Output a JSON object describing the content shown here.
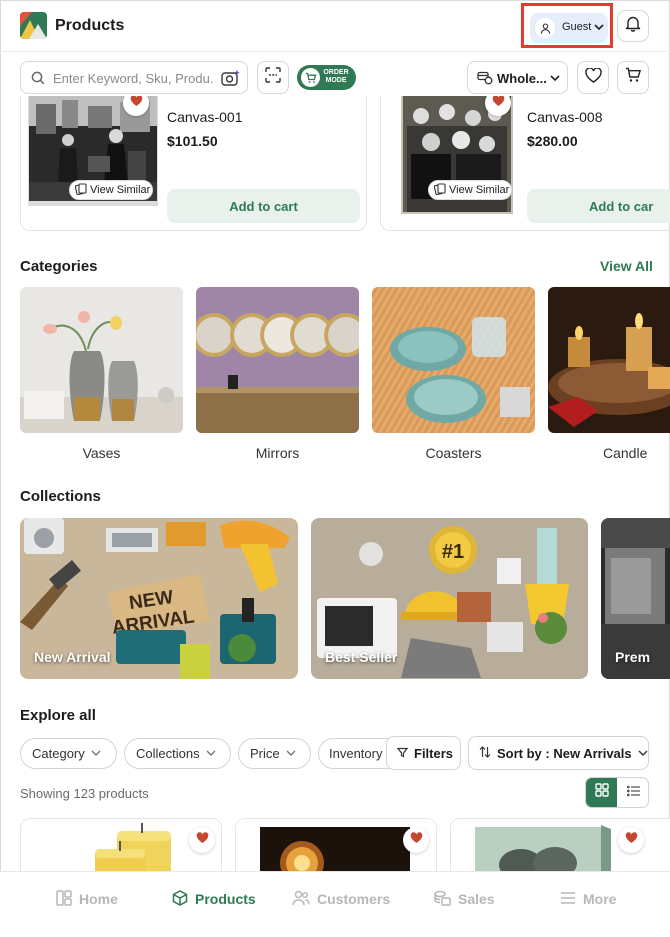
{
  "header": {
    "title": "Products",
    "user": {
      "label": "Guest"
    }
  },
  "toolbar": {
    "search_placeholder": "Enter Keyword, Sku, Produ...",
    "order_mode_line1": "ORDER",
    "order_mode_line2": "MODE",
    "price_type": "Whole..."
  },
  "featured_products": [
    {
      "name": "Canvas-001",
      "price": "$101.50",
      "view_similar": "View Similar",
      "add_label": "Add to cart"
    },
    {
      "name": "Canvas-008",
      "price": "$280.00",
      "view_similar": "View Similar",
      "add_label": "Add to car"
    }
  ],
  "categories": {
    "title": "Categories",
    "view_all": "View All",
    "items": [
      "Vases",
      "Mirrors",
      "Coasters",
      "Candle"
    ]
  },
  "collections": {
    "title": "Collections",
    "items": [
      "New Arrival",
      "Best Seller",
      "Prem"
    ],
    "banner_text_1": "NEW",
    "banner_text_2": "ARRIVAL",
    "badge_text": "#1"
  },
  "explore": {
    "title": "Explore all",
    "filters": [
      "Category",
      "Collections",
      "Price",
      "Inventory"
    ],
    "filters_button": "Filters",
    "sort_label": "Sort by : New Arrivals",
    "showing": "Showing 123 products"
  },
  "bottom_nav": [
    {
      "label": "Home",
      "icon": "home-icon"
    },
    {
      "label": "Products",
      "icon": "box-icon"
    },
    {
      "label": "Customers",
      "icon": "users-icon"
    },
    {
      "label": "Sales",
      "icon": "coins-icon"
    },
    {
      "label": "More",
      "icon": "menu-icon"
    }
  ],
  "colors": {
    "accent": "#2f7a54",
    "highlight": "#e33b2f",
    "heart": "#c6462f"
  }
}
